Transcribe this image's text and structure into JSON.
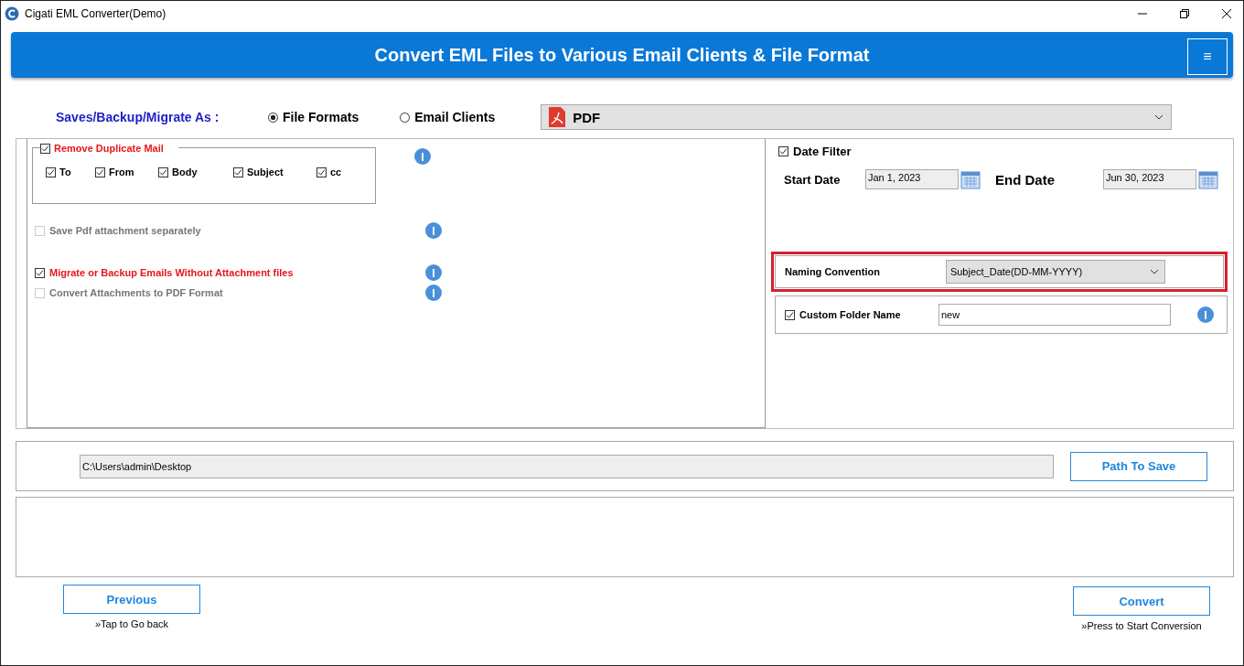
{
  "window": {
    "title": "Cigati EML Converter(Demo)"
  },
  "banner": {
    "title": "Convert EML Files to Various Email Clients & File Format",
    "menu": "≡"
  },
  "save_as": {
    "label": "Saves/Backup/Migrate As :",
    "options": [
      {
        "label": "File Formats",
        "selected": true
      },
      {
        "label": "Email Clients",
        "selected": false
      }
    ],
    "format": "PDF"
  },
  "duplicate_filter": {
    "label": "Remove Duplicate Mail",
    "checked": true,
    "fields": [
      {
        "label": "To",
        "checked": true
      },
      {
        "label": "From",
        "checked": true
      },
      {
        "label": "Body",
        "checked": true
      },
      {
        "label": "Subject",
        "checked": true
      },
      {
        "label": "cc",
        "checked": true
      }
    ]
  },
  "options": [
    {
      "label": "Save Pdf attachment separately",
      "checked": false,
      "disabled": true
    },
    {
      "label": "Migrate or Backup Emails Without Attachment files",
      "checked": true,
      "disabled": false
    },
    {
      "label": "Convert Attachments to PDF Format",
      "checked": false,
      "disabled": true
    }
  ],
  "date_filter": {
    "label": "Date Filter",
    "checked": true,
    "start_label": "Start Date",
    "start": "Jan 1, 2023",
    "end_label": "End Date",
    "end": "Jun 30, 2023"
  },
  "naming": {
    "label": "Naming Convention",
    "value": "Subject_Date(DD-MM-YYYY)",
    "highlighted": true
  },
  "custom_folder": {
    "label": "Custom Folder Name",
    "checked": true,
    "value": "new"
  },
  "path": {
    "value": "C:\\Users\\admin\\Desktop",
    "button": "Path To Save"
  },
  "footer": {
    "previous": "Previous",
    "previous_hint": "»Tap to Go back",
    "convert": "Convert",
    "convert_hint": "»Press to Start Conversion"
  }
}
